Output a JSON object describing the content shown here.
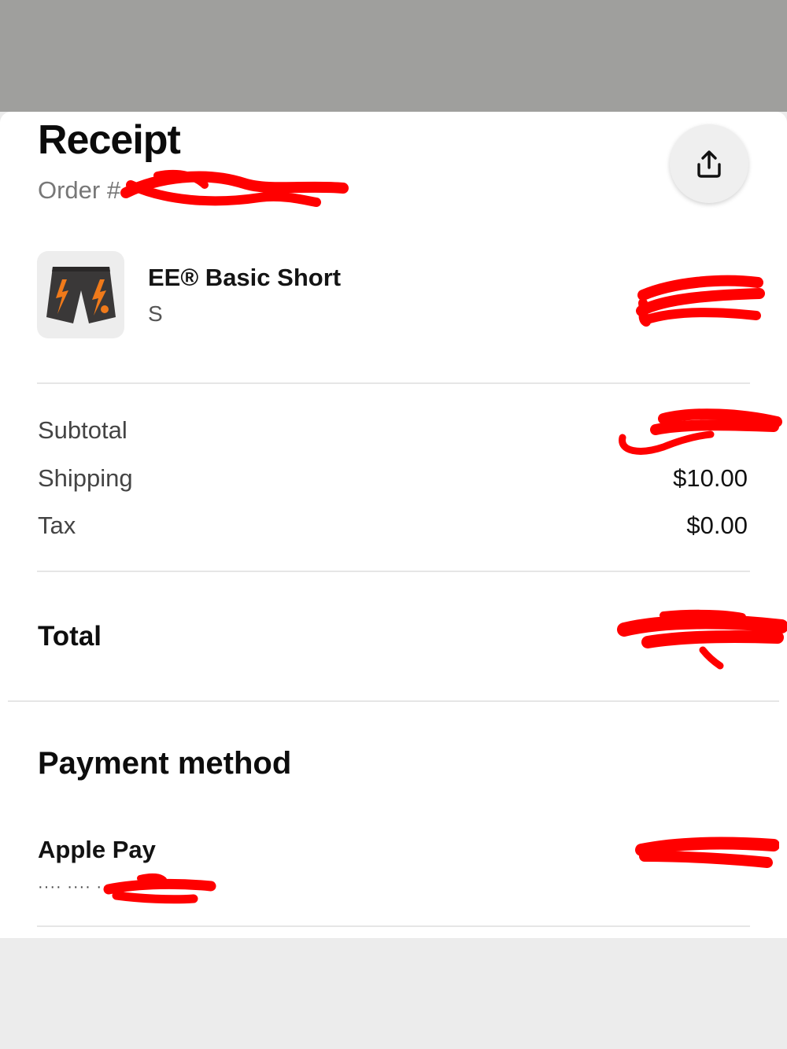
{
  "receipt": {
    "title": "Receipt",
    "order_label": "Order #",
    "share_icon": "share-icon"
  },
  "item": {
    "name": "EE® Basic Short",
    "variant": "S",
    "thumbnail_icon": "shorts-thumbnail"
  },
  "summary": {
    "subtotal_label": "Subtotal",
    "shipping_label": "Shipping",
    "shipping_value": "$10.00",
    "tax_label": "Tax",
    "tax_value": "$0.00"
  },
  "total": {
    "label": "Total"
  },
  "payment": {
    "heading": "Payment method",
    "name": "Apple Pay",
    "masked_number": "···· ···· ···"
  },
  "colors": {
    "redaction": "#ff0000",
    "shorts_body": "#3a3838",
    "shorts_accent": "#f07a1a"
  }
}
